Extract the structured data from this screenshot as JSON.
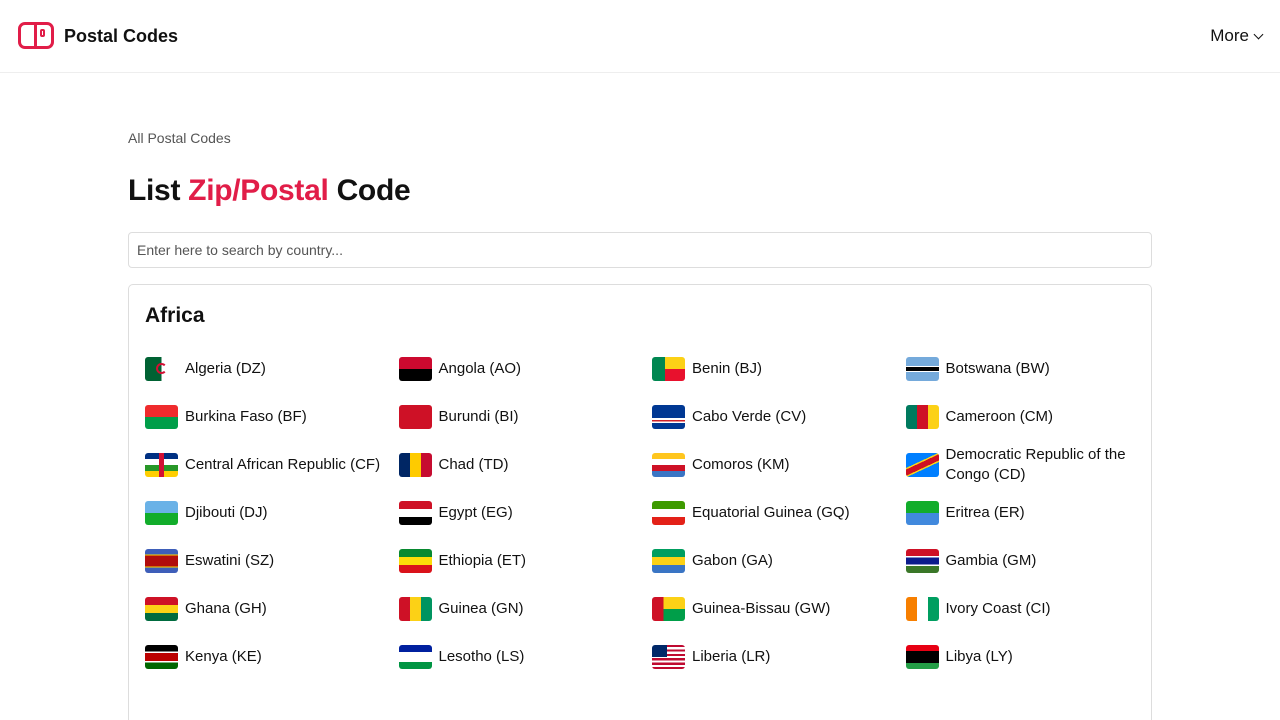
{
  "header": {
    "brand": "Postal Codes",
    "more_label": "More"
  },
  "breadcrumb": "All Postal Codes",
  "title": {
    "prefix": "List ",
    "accent": "Zip/Postal",
    "suffix": " Code"
  },
  "search": {
    "placeholder": "Enter here to search by country...",
    "value": ""
  },
  "accent_color": "#e11d48",
  "regions": [
    {
      "name": "Africa",
      "countries": [
        {
          "label": "Algeria (DZ)",
          "icon": "flag-dz-icon"
        },
        {
          "label": "Angola (AO)",
          "icon": "flag-ao-icon"
        },
        {
          "label": "Benin (BJ)",
          "icon": "flag-bj-icon"
        },
        {
          "label": "Botswana (BW)",
          "icon": "flag-bw-icon"
        },
        {
          "label": "Burkina Faso (BF)",
          "icon": "flag-bf-icon"
        },
        {
          "label": "Burundi (BI)",
          "icon": "flag-bi-icon"
        },
        {
          "label": "Cabo Verde (CV)",
          "icon": "flag-cv-icon"
        },
        {
          "label": "Cameroon (CM)",
          "icon": "flag-cm-icon"
        },
        {
          "label": "Central African Republic (CF)",
          "icon": "flag-cf-icon"
        },
        {
          "label": "Chad (TD)",
          "icon": "flag-td-icon"
        },
        {
          "label": "Comoros (KM)",
          "icon": "flag-km-icon"
        },
        {
          "label": "Democratic Republic of the Congo (CD)",
          "icon": "flag-cd-icon"
        },
        {
          "label": "Djibouti (DJ)",
          "icon": "flag-dj-icon"
        },
        {
          "label": "Egypt (EG)",
          "icon": "flag-eg-icon"
        },
        {
          "label": "Equatorial Guinea (GQ)",
          "icon": "flag-gq-icon"
        },
        {
          "label": "Eritrea (ER)",
          "icon": "flag-er-icon"
        },
        {
          "label": "Eswatini (SZ)",
          "icon": "flag-sz-icon"
        },
        {
          "label": "Ethiopia (ET)",
          "icon": "flag-et-icon"
        },
        {
          "label": "Gabon (GA)",
          "icon": "flag-ga-icon"
        },
        {
          "label": "Gambia (GM)",
          "icon": "flag-gm-icon"
        },
        {
          "label": "Ghana (GH)",
          "icon": "flag-gh-icon"
        },
        {
          "label": "Guinea (GN)",
          "icon": "flag-gn-icon"
        },
        {
          "label": "Guinea-Bissau (GW)",
          "icon": "flag-gw-icon"
        },
        {
          "label": "Ivory Coast (CI)",
          "icon": "flag-ci-icon"
        },
        {
          "label": "Kenya (KE)",
          "icon": "flag-ke-icon"
        },
        {
          "label": "Lesotho (LS)",
          "icon": "flag-ls-icon"
        },
        {
          "label": "Liberia (LR)",
          "icon": "flag-lr-icon"
        },
        {
          "label": "Libya (LY)",
          "icon": "flag-ly-icon"
        }
      ]
    }
  ]
}
